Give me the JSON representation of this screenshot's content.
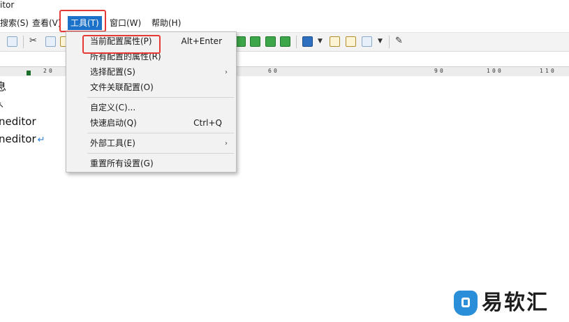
{
  "window": {
    "title_fragment": "itor"
  },
  "menubar": {
    "items": [
      {
        "label": "搜索(S)"
      },
      {
        "label": "查看(V)"
      },
      {
        "label": "工具(T)"
      },
      {
        "label": "窗口(W)"
      },
      {
        "label": "帮助(H)"
      }
    ],
    "active_item": "工具(T)"
  },
  "toolbar": {
    "icons": [
      "search-icon",
      "cut-icon",
      "copy-icon",
      "paste-icon",
      "table-icon",
      "refresh-icon",
      "undo-icon",
      "redo-icon",
      "browser-icon",
      "dropdown-arrow-icon",
      "edit-icon",
      "compare-icon",
      "checklist-icon",
      "dropdown-arrow-icon",
      "tools-icon"
    ]
  },
  "ruler": {
    "labels": [
      "2",
      "0",
      "6",
      "0",
      "9",
      "0",
      "1",
      "0",
      "0",
      "1",
      "1",
      "0"
    ]
  },
  "editor": {
    "lines": [
      {
        "text": "息"
      },
      {
        "text": "↖"
      },
      {
        "text": "neditor"
      },
      {
        "text": "neditor",
        "return_mark": "↵"
      }
    ]
  },
  "tools_menu": {
    "items": [
      {
        "label": "当前配置属性(P)",
        "shortcut": "Alt+Enter",
        "submenu": false,
        "highlighted": true
      },
      {
        "label": "所有配置的属性(R)",
        "shortcut": "",
        "submenu": false
      },
      {
        "label": "选择配置(S)",
        "shortcut": "",
        "submenu": true
      },
      {
        "label": "文件关联配置(O)",
        "shortcut": "",
        "submenu": false
      },
      {
        "label": "自定义(C)...",
        "shortcut": "",
        "submenu": false
      },
      {
        "label": "快速启动(Q)",
        "shortcut": "Ctrl+Q",
        "submenu": false
      },
      {
        "label": "外部工具(E)",
        "shortcut": "",
        "submenu": true
      },
      {
        "label": "重置所有设置(G)",
        "shortcut": "",
        "submenu": false
      }
    ],
    "submenu_arrow": "›"
  },
  "watermark": {
    "text": "易软汇",
    "color": "#2a8fd8"
  },
  "colors": {
    "menu_active": "#1c72c9",
    "highlight_box": "#e53935"
  }
}
